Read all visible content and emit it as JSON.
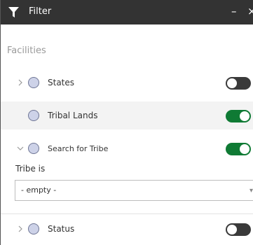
{
  "header": {
    "icon": "filter-icon",
    "title": "Filter",
    "minimize": "–",
    "close": "×"
  },
  "section": {
    "title": "Facilities"
  },
  "layers": [
    {
      "label": "States",
      "expandable": true,
      "expanded": false,
      "enabled": false
    },
    {
      "label": "Tribal Lands",
      "expandable": false,
      "expanded": false,
      "enabled": true
    },
    {
      "label": "Search for Tribe",
      "expandable": true,
      "expanded": true,
      "enabled": true
    },
    {
      "label": "Status",
      "expandable": true,
      "expanded": false,
      "enabled": false
    }
  ],
  "tribe_filter": {
    "label": "Tribe is",
    "value": "- empty -"
  },
  "colors": {
    "header_bg": "#333333",
    "toggle_on": "#0f7a34",
    "toggle_off": "#3a3a3a",
    "radio_fill": "#cdd2e8"
  }
}
